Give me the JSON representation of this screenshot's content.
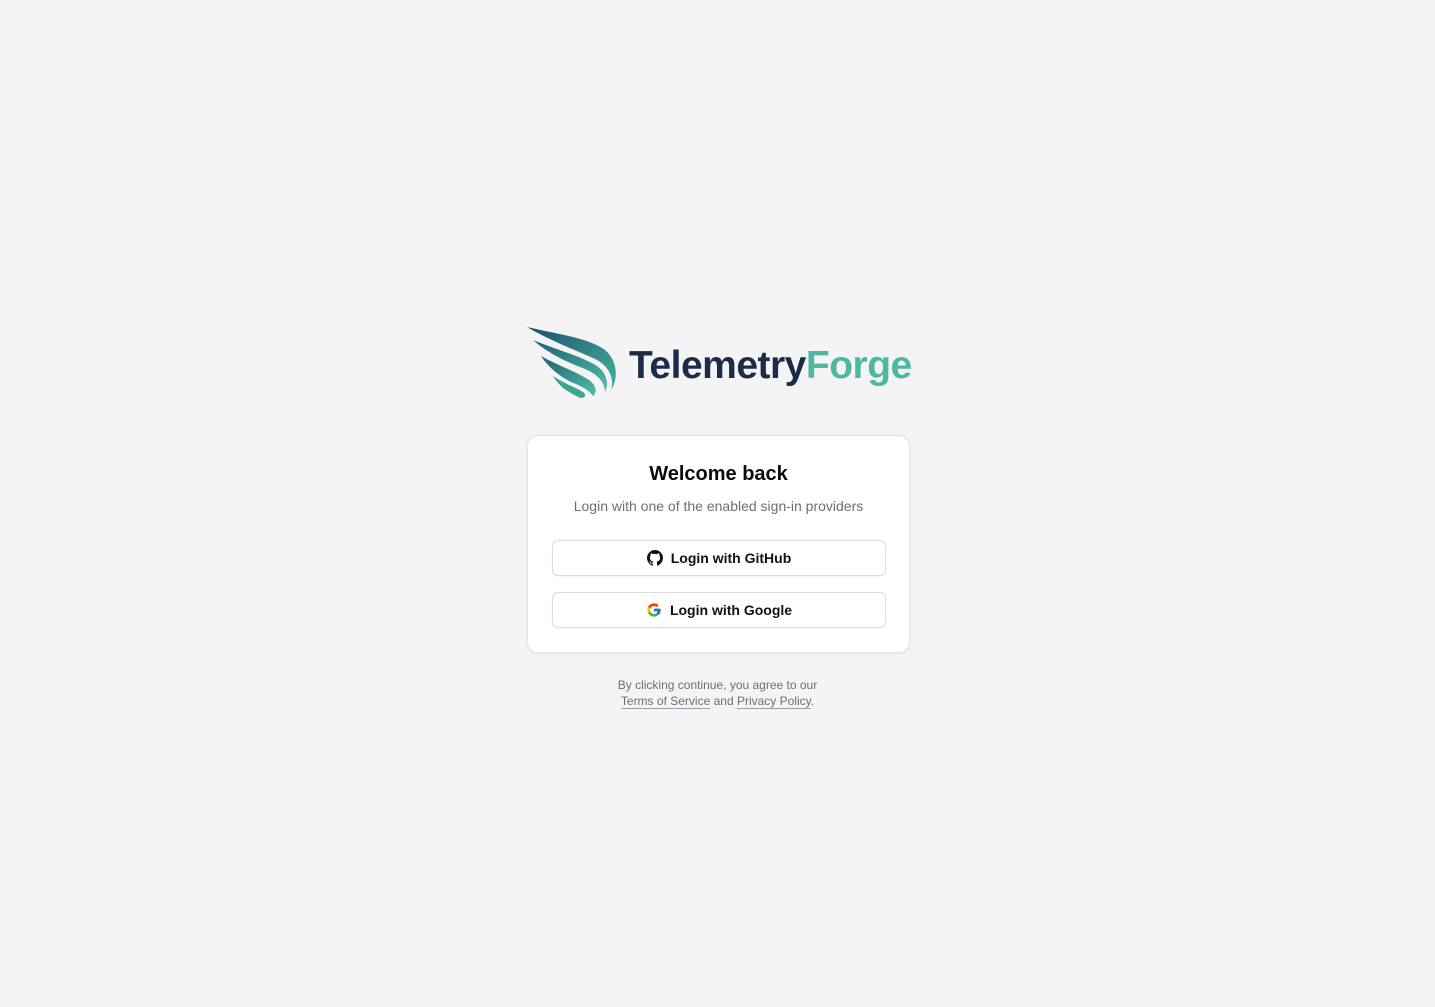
{
  "brand": {
    "name_part1": "Telemetry",
    "name_part2": "Forge",
    "color_dark": "#1c2b4a",
    "color_accent": "#4db7a2",
    "logo_icon": "wing-logo-icon"
  },
  "login": {
    "title": "Welcome back",
    "subtitle": "Login with one of the enabled sign-in providers",
    "providers": [
      {
        "label": "Login with GitHub",
        "icon": "github-icon"
      },
      {
        "label": "Login with Google",
        "icon": "google-icon"
      }
    ]
  },
  "legal": {
    "prefix": "By clicking continue, you agree to our",
    "terms_label": "Terms of Service",
    "and": "and",
    "privacy_label": "Privacy Policy",
    "suffix": "."
  },
  "colors": {
    "background": "#f4f4f4",
    "card": "#ffffff",
    "muted_text": "#6b6f76"
  }
}
